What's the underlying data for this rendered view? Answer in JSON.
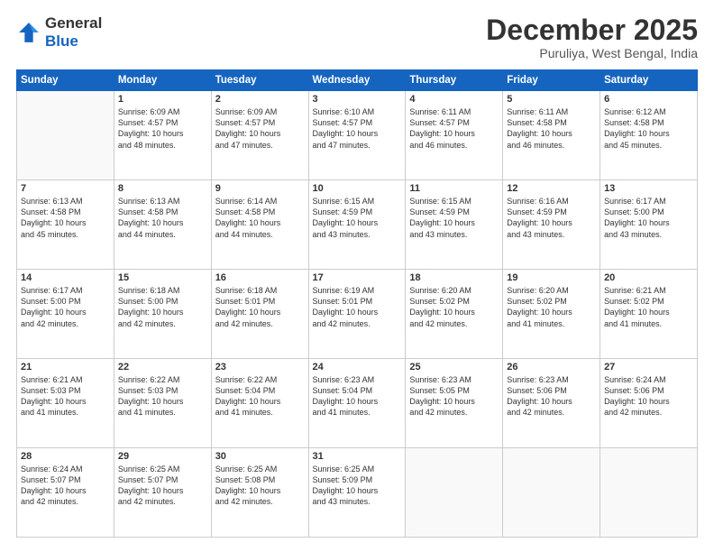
{
  "header": {
    "logo": {
      "line1": "General",
      "line2": "Blue"
    },
    "title": "December 2025",
    "location": "Puruliya, West Bengal, India"
  },
  "weekdays": [
    "Sunday",
    "Monday",
    "Tuesday",
    "Wednesday",
    "Thursday",
    "Friday",
    "Saturday"
  ],
  "weeks": [
    [
      {
        "day": "",
        "sunrise": "",
        "sunset": "",
        "daylight": ""
      },
      {
        "day": "1",
        "sunrise": "Sunrise: 6:09 AM",
        "sunset": "Sunset: 4:57 PM",
        "daylight": "Daylight: 10 hours",
        "daylight2": "and 48 minutes."
      },
      {
        "day": "2",
        "sunrise": "Sunrise: 6:09 AM",
        "sunset": "Sunset: 4:57 PM",
        "daylight": "Daylight: 10 hours",
        "daylight2": "and 47 minutes."
      },
      {
        "day": "3",
        "sunrise": "Sunrise: 6:10 AM",
        "sunset": "Sunset: 4:57 PM",
        "daylight": "Daylight: 10 hours",
        "daylight2": "and 47 minutes."
      },
      {
        "day": "4",
        "sunrise": "Sunrise: 6:11 AM",
        "sunset": "Sunset: 4:57 PM",
        "daylight": "Daylight: 10 hours",
        "daylight2": "and 46 minutes."
      },
      {
        "day": "5",
        "sunrise": "Sunrise: 6:11 AM",
        "sunset": "Sunset: 4:58 PM",
        "daylight": "Daylight: 10 hours",
        "daylight2": "and 46 minutes."
      },
      {
        "day": "6",
        "sunrise": "Sunrise: 6:12 AM",
        "sunset": "Sunset: 4:58 PM",
        "daylight": "Daylight: 10 hours",
        "daylight2": "and 45 minutes."
      }
    ],
    [
      {
        "day": "7",
        "sunrise": "Sunrise: 6:13 AM",
        "sunset": "Sunset: 4:58 PM",
        "daylight": "Daylight: 10 hours",
        "daylight2": "and 45 minutes."
      },
      {
        "day": "8",
        "sunrise": "Sunrise: 6:13 AM",
        "sunset": "Sunset: 4:58 PM",
        "daylight": "Daylight: 10 hours",
        "daylight2": "and 44 minutes."
      },
      {
        "day": "9",
        "sunrise": "Sunrise: 6:14 AM",
        "sunset": "Sunset: 4:58 PM",
        "daylight": "Daylight: 10 hours",
        "daylight2": "and 44 minutes."
      },
      {
        "day": "10",
        "sunrise": "Sunrise: 6:15 AM",
        "sunset": "Sunset: 4:59 PM",
        "daylight": "Daylight: 10 hours",
        "daylight2": "and 43 minutes."
      },
      {
        "day": "11",
        "sunrise": "Sunrise: 6:15 AM",
        "sunset": "Sunset: 4:59 PM",
        "daylight": "Daylight: 10 hours",
        "daylight2": "and 43 minutes."
      },
      {
        "day": "12",
        "sunrise": "Sunrise: 6:16 AM",
        "sunset": "Sunset: 4:59 PM",
        "daylight": "Daylight: 10 hours",
        "daylight2": "and 43 minutes."
      },
      {
        "day": "13",
        "sunrise": "Sunrise: 6:17 AM",
        "sunset": "Sunset: 5:00 PM",
        "daylight": "Daylight: 10 hours",
        "daylight2": "and 43 minutes."
      }
    ],
    [
      {
        "day": "14",
        "sunrise": "Sunrise: 6:17 AM",
        "sunset": "Sunset: 5:00 PM",
        "daylight": "Daylight: 10 hours",
        "daylight2": "and 42 minutes."
      },
      {
        "day": "15",
        "sunrise": "Sunrise: 6:18 AM",
        "sunset": "Sunset: 5:00 PM",
        "daylight": "Daylight: 10 hours",
        "daylight2": "and 42 minutes."
      },
      {
        "day": "16",
        "sunrise": "Sunrise: 6:18 AM",
        "sunset": "Sunset: 5:01 PM",
        "daylight": "Daylight: 10 hours",
        "daylight2": "and 42 minutes."
      },
      {
        "day": "17",
        "sunrise": "Sunrise: 6:19 AM",
        "sunset": "Sunset: 5:01 PM",
        "daylight": "Daylight: 10 hours",
        "daylight2": "and 42 minutes."
      },
      {
        "day": "18",
        "sunrise": "Sunrise: 6:20 AM",
        "sunset": "Sunset: 5:02 PM",
        "daylight": "Daylight: 10 hours",
        "daylight2": "and 42 minutes."
      },
      {
        "day": "19",
        "sunrise": "Sunrise: 6:20 AM",
        "sunset": "Sunset: 5:02 PM",
        "daylight": "Daylight: 10 hours",
        "daylight2": "and 41 minutes."
      },
      {
        "day": "20",
        "sunrise": "Sunrise: 6:21 AM",
        "sunset": "Sunset: 5:02 PM",
        "daylight": "Daylight: 10 hours",
        "daylight2": "and 41 minutes."
      }
    ],
    [
      {
        "day": "21",
        "sunrise": "Sunrise: 6:21 AM",
        "sunset": "Sunset: 5:03 PM",
        "daylight": "Daylight: 10 hours",
        "daylight2": "and 41 minutes."
      },
      {
        "day": "22",
        "sunrise": "Sunrise: 6:22 AM",
        "sunset": "Sunset: 5:03 PM",
        "daylight": "Daylight: 10 hours",
        "daylight2": "and 41 minutes."
      },
      {
        "day": "23",
        "sunrise": "Sunrise: 6:22 AM",
        "sunset": "Sunset: 5:04 PM",
        "daylight": "Daylight: 10 hours",
        "daylight2": "and 41 minutes."
      },
      {
        "day": "24",
        "sunrise": "Sunrise: 6:23 AM",
        "sunset": "Sunset: 5:04 PM",
        "daylight": "Daylight: 10 hours",
        "daylight2": "and 41 minutes."
      },
      {
        "day": "25",
        "sunrise": "Sunrise: 6:23 AM",
        "sunset": "Sunset: 5:05 PM",
        "daylight": "Daylight: 10 hours",
        "daylight2": "and 42 minutes."
      },
      {
        "day": "26",
        "sunrise": "Sunrise: 6:23 AM",
        "sunset": "Sunset: 5:06 PM",
        "daylight": "Daylight: 10 hours",
        "daylight2": "and 42 minutes."
      },
      {
        "day": "27",
        "sunrise": "Sunrise: 6:24 AM",
        "sunset": "Sunset: 5:06 PM",
        "daylight": "Daylight: 10 hours",
        "daylight2": "and 42 minutes."
      }
    ],
    [
      {
        "day": "28",
        "sunrise": "Sunrise: 6:24 AM",
        "sunset": "Sunset: 5:07 PM",
        "daylight": "Daylight: 10 hours",
        "daylight2": "and 42 minutes."
      },
      {
        "day": "29",
        "sunrise": "Sunrise: 6:25 AM",
        "sunset": "Sunset: 5:07 PM",
        "daylight": "Daylight: 10 hours",
        "daylight2": "and 42 minutes."
      },
      {
        "day": "30",
        "sunrise": "Sunrise: 6:25 AM",
        "sunset": "Sunset: 5:08 PM",
        "daylight": "Daylight: 10 hours",
        "daylight2": "and 42 minutes."
      },
      {
        "day": "31",
        "sunrise": "Sunrise: 6:25 AM",
        "sunset": "Sunset: 5:09 PM",
        "daylight": "Daylight: 10 hours",
        "daylight2": "and 43 minutes."
      },
      {
        "day": "",
        "sunrise": "",
        "sunset": "",
        "daylight": "",
        "daylight2": ""
      },
      {
        "day": "",
        "sunrise": "",
        "sunset": "",
        "daylight": "",
        "daylight2": ""
      },
      {
        "day": "",
        "sunrise": "",
        "sunset": "",
        "daylight": "",
        "daylight2": ""
      }
    ]
  ]
}
